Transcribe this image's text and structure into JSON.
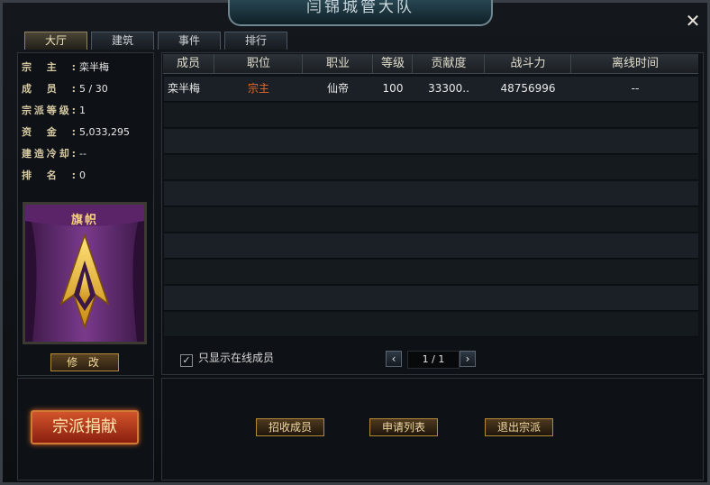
{
  "window": {
    "title": "闫锦城管大队",
    "close_icon": "close-icon"
  },
  "tabs": [
    {
      "label": "大厅",
      "active": true
    },
    {
      "label": "建筑",
      "active": false
    },
    {
      "label": "事件",
      "active": false
    },
    {
      "label": "排行",
      "active": false
    }
  ],
  "sect_info": {
    "leader_label": "宗主:",
    "leader": "栾半梅",
    "members_label": "成员:",
    "members": "5 / 30",
    "level_label": "宗派等级:",
    "level": "1",
    "funds_label": "资金:",
    "funds": "5,033,295",
    "cooldown_label": "建造冷却:",
    "cooldown": "--",
    "rank_label": "排名:",
    "rank": "0"
  },
  "banner": {
    "title": "旗帜",
    "modify_label": "修 改",
    "emblem_icon": "sect-emblem-icon"
  },
  "donate_label": "宗派捐献",
  "table": {
    "headers": [
      "成员",
      "职位",
      "职业",
      "等级",
      "贡献度",
      "战斗力",
      "离线时间"
    ],
    "rows": [
      {
        "name": "栾半梅",
        "role": "宗主",
        "class": "仙帝",
        "level": "100",
        "contribution": "33300..",
        "power": "48756996",
        "offline": "--"
      }
    ]
  },
  "filter": {
    "online_only_label": "只显示在线成员",
    "checked": true
  },
  "pager": {
    "text": "1 / 1"
  },
  "actions": {
    "recruit_label": "招收成员",
    "applications_label": "申请列表",
    "leave_label": "退出宗派"
  },
  "colors": {
    "role_leader": "#e06a2a",
    "donate_button": "#c8462a",
    "gold_border": "#b4893a"
  }
}
